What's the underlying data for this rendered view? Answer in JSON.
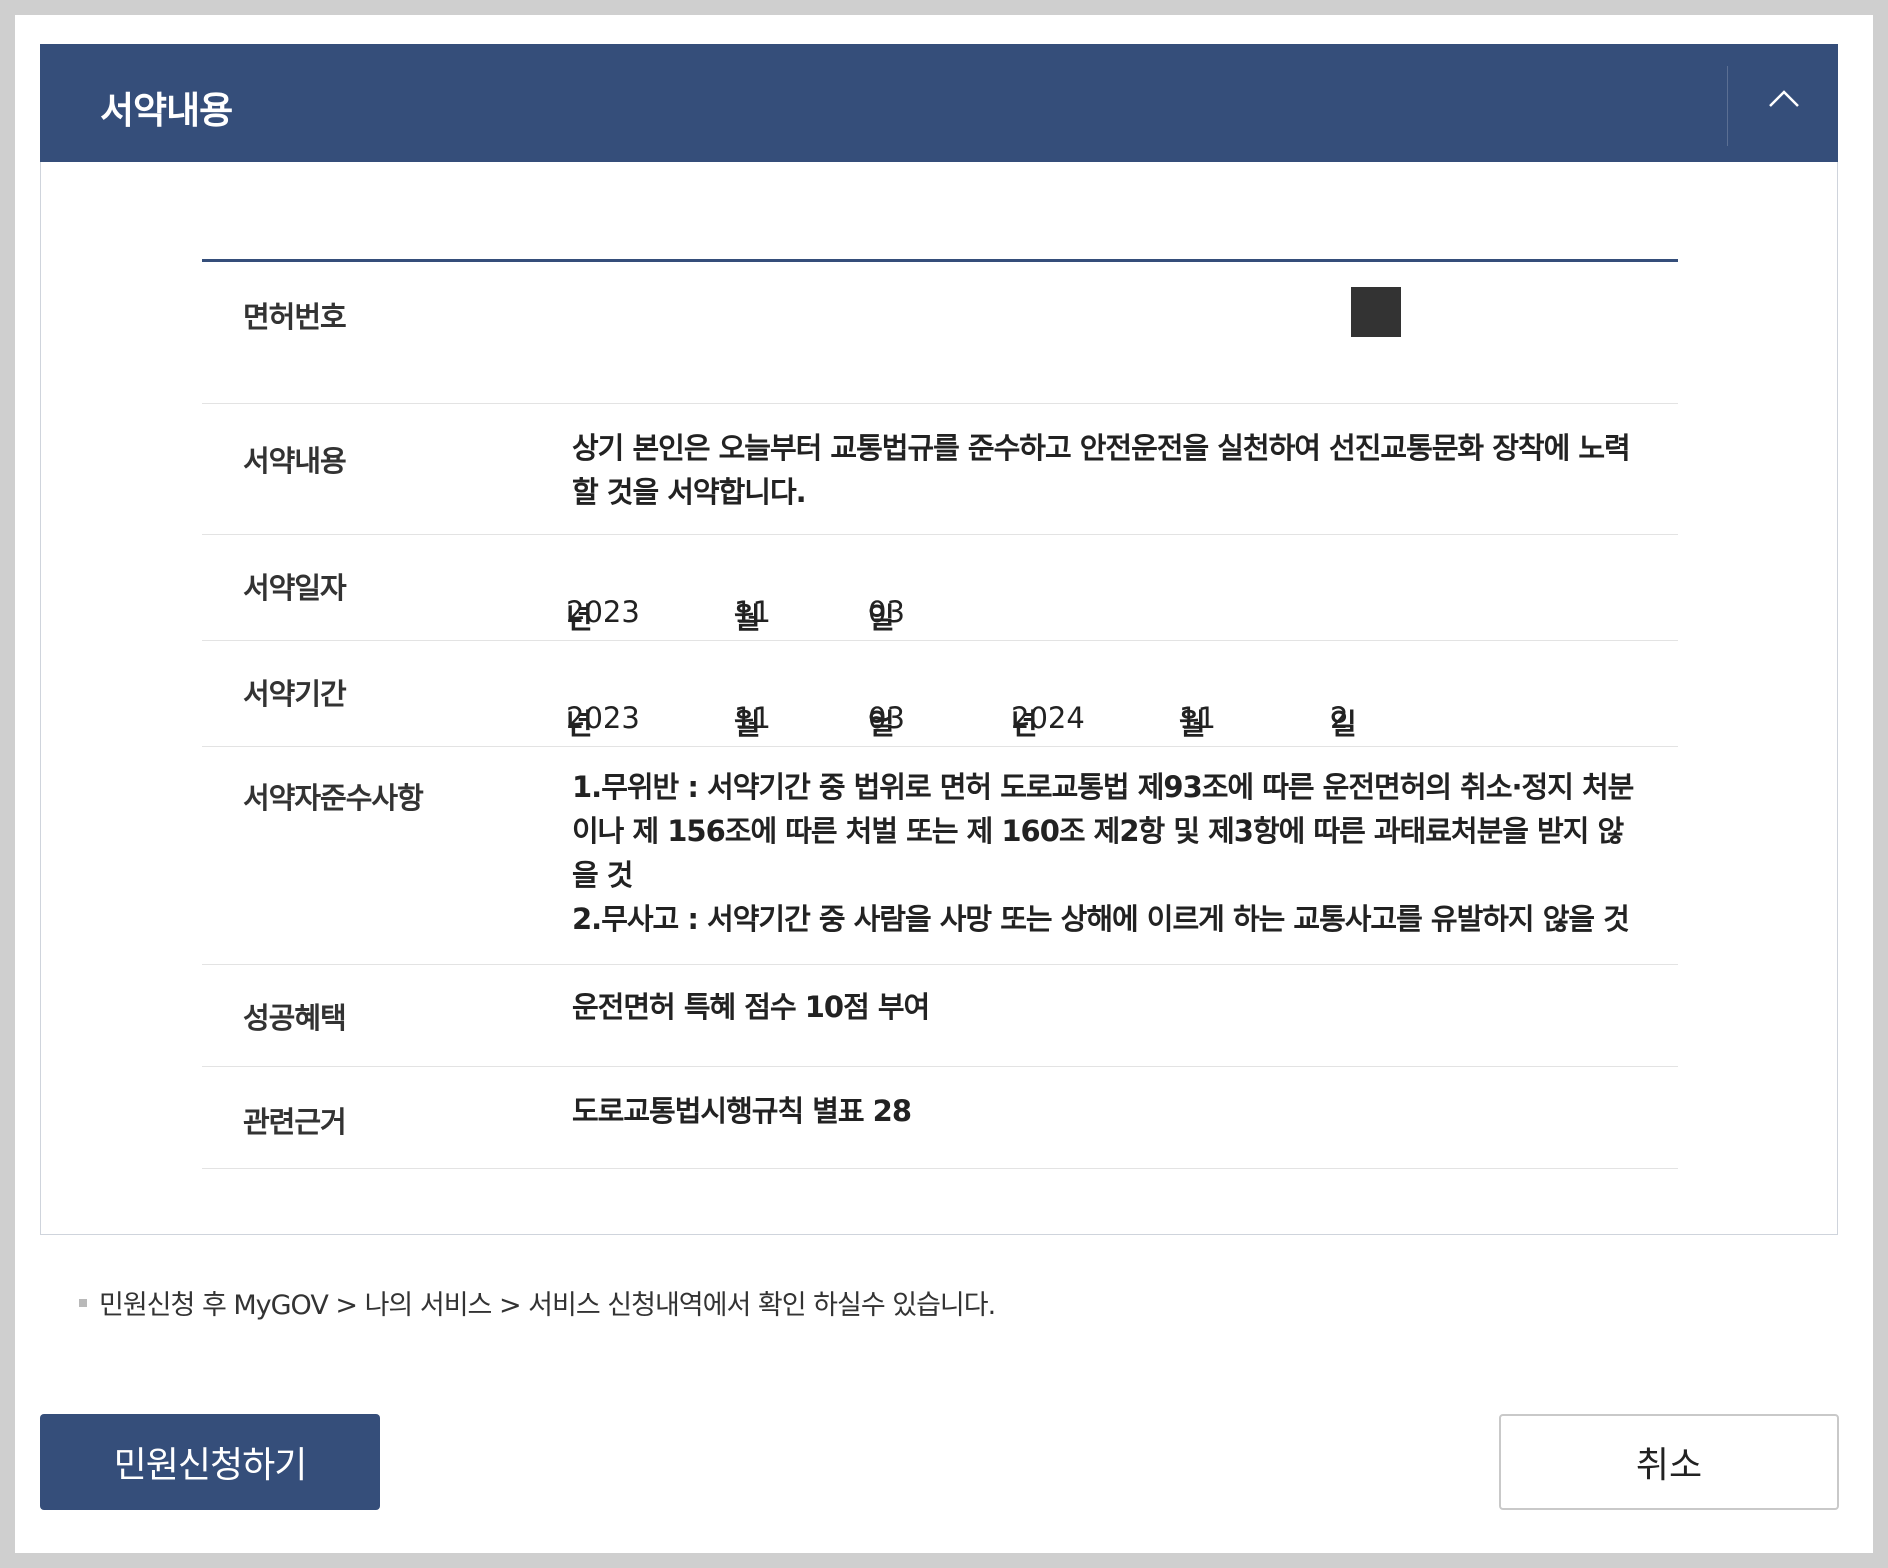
{
  "panel": {
    "title": "서약내용",
    "collapse_icon": "chevron-up-icon"
  },
  "table": {
    "license": {
      "label": "면허번호",
      "value_masked": true
    },
    "content": {
      "label": "서약내용",
      "value": "상기 본인은 오늘부터 교통법규를 준수하고 안전운전을 실천하여 선진교통문화 장착에 노력할 것을 서약합니다."
    },
    "date": {
      "label": "서약일자",
      "year": "2023",
      "year_unit": "년",
      "month": "11",
      "month_unit": "월",
      "day": "03",
      "day_unit": "일"
    },
    "period": {
      "label": "서약기간",
      "start_year": "2023",
      "start_year_unit": "년",
      "start_month": "11",
      "start_month_unit": "월",
      "start_day": "03",
      "start_day_unit": "일",
      "separator": "~",
      "end_year": "2024",
      "end_year_unit": "년",
      "end_month": "11",
      "end_month_unit": "월",
      "end_day": "2",
      "end_day_unit": "일"
    },
    "rules": {
      "label": "서약자준수사항",
      "item1": "1.무위반 : 서약기간 중 법위로 면허 도로교통법 제93조에 따른 운전면허의 취소·정지 처분이나 제 156조에 따른 처벌 또는 제 160조 제2항 및 제3항에 따른 과태료처분을 받지 않을 것",
      "item2": "2.무사고 : 서약기간 중 사람을 사망 또는 상해에 이르게 하는 교통사고를 유발하지 않을 것"
    },
    "benefit": {
      "label": "성공혜택",
      "value": "운전면허 특혜 점수 10점 부여"
    },
    "basis": {
      "label": "관련근거",
      "value": "도로교통법시행규칙 별표 28"
    }
  },
  "note": "민원신청 후 MyGOV > 나의 서비스 > 서비스 신청내역에서 확인 하실수 있습니다.",
  "buttons": {
    "submit": "민원신청하기",
    "cancel": "취소"
  },
  "colors": {
    "header": "#354e7a",
    "background": "#cfcfcf"
  }
}
